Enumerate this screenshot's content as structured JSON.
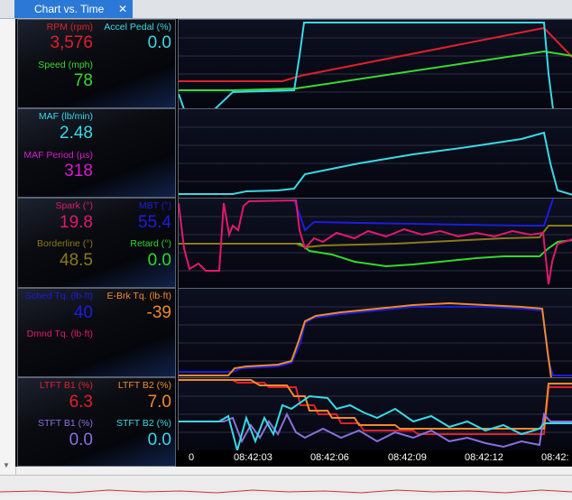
{
  "tab": {
    "title": "Chart vs. Time",
    "close": "✕"
  },
  "rows": [
    {
      "id": "rpm",
      "params": [
        {
          "label": "RPM (rpm)",
          "value": "3,576",
          "color": "#e0202a"
        },
        {
          "label": "Accel Pedal (%)",
          "value": "0.0",
          "color": "#39d9e6"
        },
        {
          "label": "Speed (mph)",
          "value": "78",
          "color": "#39d933"
        }
      ]
    },
    {
      "id": "maf",
      "params": [
        {
          "label": "MAF (lb/min)",
          "value": "2.48",
          "color": "#39d9e6"
        },
        {
          "label": "MAF Period (µs)",
          "value": "318",
          "color": "#d61bd1"
        }
      ]
    },
    {
      "id": "spark",
      "params": [
        {
          "label": "Spark (°)",
          "value": "19.8",
          "color": "#e2196a"
        },
        {
          "label": "MBT (°)",
          "value": "55.4",
          "color": "#1c1ce0"
        },
        {
          "label": "Borderline (°)",
          "value": "48.5",
          "color": "#8a7a18"
        },
        {
          "label": "Retard (°)",
          "value": "0.0",
          "color": "#30d92a"
        }
      ]
    },
    {
      "id": "torque",
      "params": [
        {
          "label": "Sched Tq. (lb·ft)",
          "value": "40",
          "color": "#1c1ce0"
        },
        {
          "label": "E-Brk Tq. (lb·ft)",
          "value": "-39",
          "color": "#f08a2a"
        },
        {
          "label": "Dmnd Tq. (lb·ft)",
          "value": "",
          "color": "#e2196a"
        }
      ]
    },
    {
      "id": "fuel-trim",
      "params": [
        {
          "label": "LTFT B1 (%)",
          "value": "6.3",
          "color": "#e0202a"
        },
        {
          "label": "LTFT B2 (%)",
          "value": "7.0",
          "color": "#f08a2a"
        },
        {
          "label": "STFT B1 (%)",
          "value": "0.0",
          "color": "#8a6fe0"
        },
        {
          "label": "STFT B2 (%)",
          "value": "0.0",
          "color": "#39d9e6"
        }
      ]
    }
  ],
  "time_axis": {
    "ticks": [
      "0",
      "08:42:03",
      "08:42:06",
      "08:42:09",
      "08:42:12",
      "08:42:"
    ]
  },
  "colors": {
    "grid": "#2a2f45",
    "border": "#5a6270"
  }
}
